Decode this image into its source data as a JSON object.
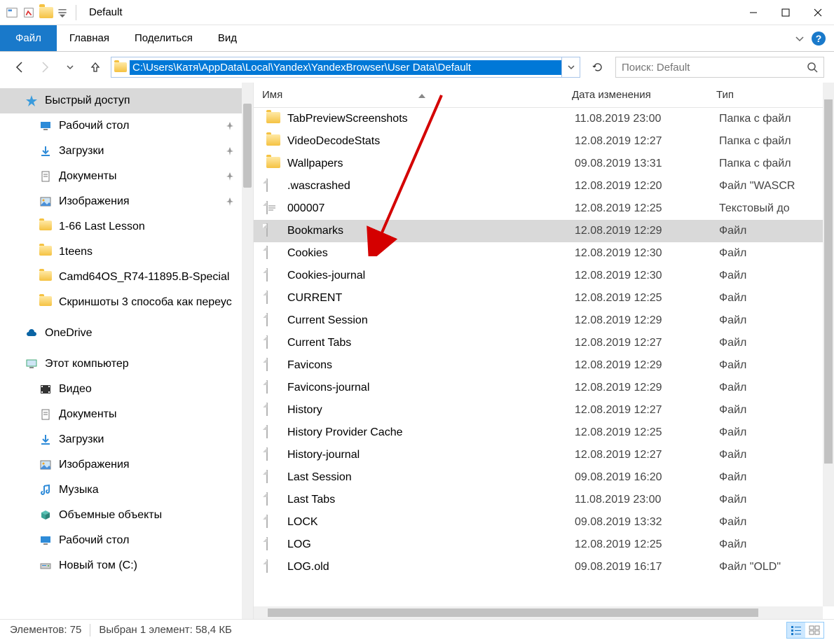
{
  "window": {
    "title": "Default"
  },
  "ribbon": {
    "file": "Файл",
    "tabs": [
      "Главная",
      "Поделиться",
      "Вид"
    ]
  },
  "nav": {
    "path": "C:\\Users\\Катя\\AppData\\Local\\Yandex\\YandexBrowser\\User Data\\Default",
    "search_placeholder": "Поиск: Default"
  },
  "sidebar": {
    "quick_access": "Быстрый доступ",
    "quick_items": [
      {
        "label": "Рабочий стол",
        "ico": "desktop",
        "pinned": true
      },
      {
        "label": "Загрузки",
        "ico": "downloads",
        "pinned": true
      },
      {
        "label": "Документы",
        "ico": "documents",
        "pinned": true
      },
      {
        "label": "Изображения",
        "ico": "pictures",
        "pinned": true
      },
      {
        "label": "1-66 Last Lesson",
        "ico": "folder",
        "pinned": false
      },
      {
        "label": "1teens",
        "ico": "folder",
        "pinned": false
      },
      {
        "label": "Camd64OS_R74-11895.B-Special",
        "ico": "folder",
        "pinned": false
      },
      {
        "label": "Скриншоты 3 способа как переус",
        "ico": "folder",
        "pinned": false
      }
    ],
    "onedrive": "OneDrive",
    "this_pc": "Этот компьютер",
    "pc_items": [
      {
        "label": "Видео",
        "ico": "video"
      },
      {
        "label": "Документы",
        "ico": "documents"
      },
      {
        "label": "Загрузки",
        "ico": "downloads"
      },
      {
        "label": "Изображения",
        "ico": "pictures"
      },
      {
        "label": "Музыка",
        "ico": "music"
      },
      {
        "label": "Объемные объекты",
        "ico": "3d"
      },
      {
        "label": "Рабочий стол",
        "ico": "desktop"
      },
      {
        "label": "Новый том (C:)",
        "ico": "drive"
      }
    ]
  },
  "columns": {
    "name": "Имя",
    "date": "Дата изменения",
    "type": "Тип"
  },
  "selected_file": "Bookmarks",
  "files": [
    {
      "name": "TabPreviewScreenshots",
      "date": "11.08.2019 23:00",
      "type": "Папка с файл",
      "kind": "folder"
    },
    {
      "name": "VideoDecodeStats",
      "date": "12.08.2019 12:27",
      "type": "Папка с файл",
      "kind": "folder"
    },
    {
      "name": "Wallpapers",
      "date": "09.08.2019 13:31",
      "type": "Папка с файл",
      "kind": "folder"
    },
    {
      "name": ".wascrashed",
      "date": "12.08.2019 12:20",
      "type": "Файл \"WASCR",
      "kind": "file"
    },
    {
      "name": "000007",
      "date": "12.08.2019 12:25",
      "type": "Текстовый до",
      "kind": "text"
    },
    {
      "name": "Bookmarks",
      "date": "12.08.2019 12:29",
      "type": "Файл",
      "kind": "file"
    },
    {
      "name": "Cookies",
      "date": "12.08.2019 12:30",
      "type": "Файл",
      "kind": "file"
    },
    {
      "name": "Cookies-journal",
      "date": "12.08.2019 12:30",
      "type": "Файл",
      "kind": "file"
    },
    {
      "name": "CURRENT",
      "date": "12.08.2019 12:25",
      "type": "Файл",
      "kind": "file"
    },
    {
      "name": "Current Session",
      "date": "12.08.2019 12:29",
      "type": "Файл",
      "kind": "file"
    },
    {
      "name": "Current Tabs",
      "date": "12.08.2019 12:27",
      "type": "Файл",
      "kind": "file"
    },
    {
      "name": "Favicons",
      "date": "12.08.2019 12:29",
      "type": "Файл",
      "kind": "file"
    },
    {
      "name": "Favicons-journal",
      "date": "12.08.2019 12:29",
      "type": "Файл",
      "kind": "file"
    },
    {
      "name": "History",
      "date": "12.08.2019 12:27",
      "type": "Файл",
      "kind": "file"
    },
    {
      "name": "History Provider Cache",
      "date": "12.08.2019 12:25",
      "type": "Файл",
      "kind": "file"
    },
    {
      "name": "History-journal",
      "date": "12.08.2019 12:27",
      "type": "Файл",
      "kind": "file"
    },
    {
      "name": "Last Session",
      "date": "09.08.2019 16:20",
      "type": "Файл",
      "kind": "file"
    },
    {
      "name": "Last Tabs",
      "date": "11.08.2019 23:00",
      "type": "Файл",
      "kind": "file"
    },
    {
      "name": "LOCK",
      "date": "09.08.2019 13:32",
      "type": "Файл",
      "kind": "file"
    },
    {
      "name": "LOG",
      "date": "12.08.2019 12:25",
      "type": "Файл",
      "kind": "file"
    },
    {
      "name": "LOG.old",
      "date": "09.08.2019 16:17",
      "type": "Файл \"OLD\"",
      "kind": "file"
    }
  ],
  "status": {
    "items_label": "Элементов:",
    "items_count": "75",
    "selection_label": "Выбран 1 элемент:",
    "selection_size": "58,4 КБ"
  }
}
